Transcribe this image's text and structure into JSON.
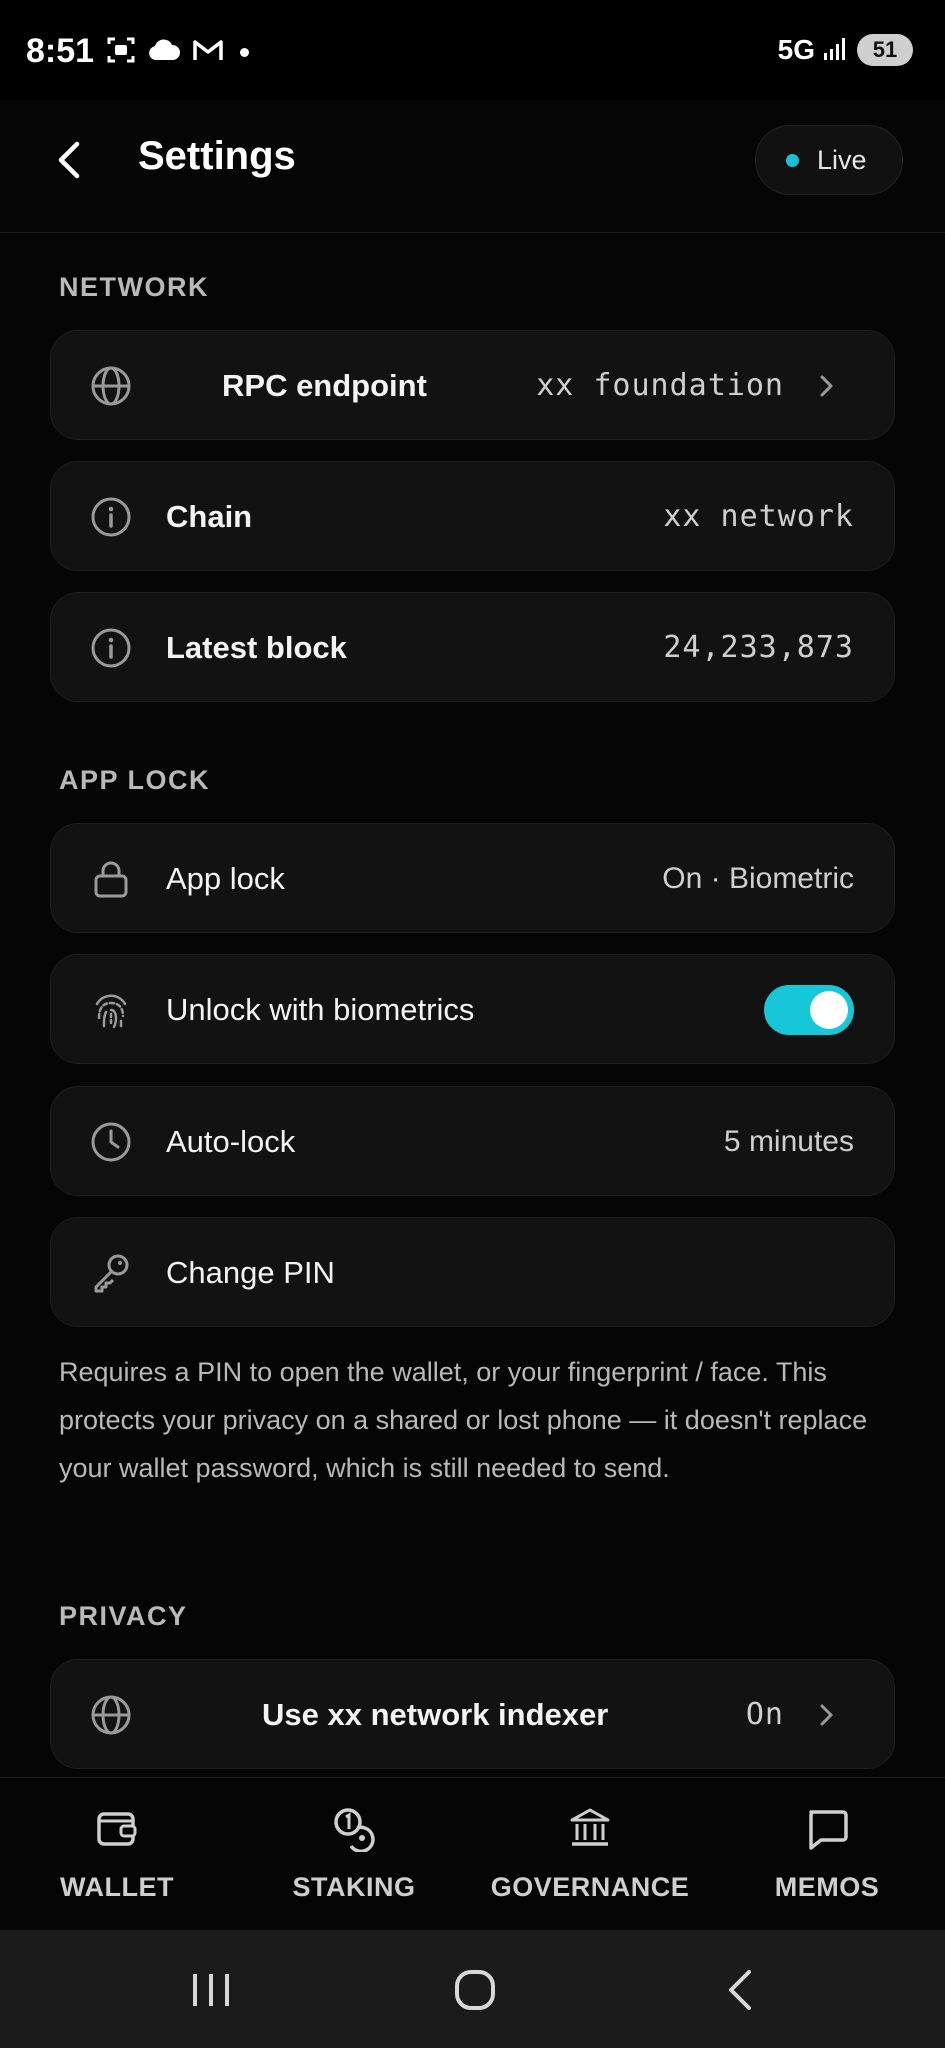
{
  "status_bar": {
    "time": "8:51",
    "network": "5G",
    "battery": "51",
    "icons": [
      "screenshot-icon",
      "cloud-icon",
      "gmail-icon",
      "notification-dot-icon",
      "signal-icon"
    ]
  },
  "header": {
    "title": "Settings",
    "status_label": "Live",
    "status_color": "#17c1d6"
  },
  "sections": {
    "network": {
      "label": "NETWORK",
      "rows": [
        {
          "label": "RPC endpoint",
          "value": "xx foundation",
          "icon": "globe-icon"
        },
        {
          "label": "Chain",
          "value": "xx network",
          "icon": "info-icon"
        },
        {
          "label": "Latest block",
          "value": "24,233,873",
          "icon": "info-icon"
        }
      ]
    },
    "app_lock": {
      "label": "APP LOCK",
      "rows": [
        {
          "label": "App lock",
          "value": "On · Biometric",
          "icon": "lock-icon"
        },
        {
          "label": "Unlock with biometrics",
          "toggle_on": true,
          "icon": "fingerprint-icon"
        },
        {
          "label": "Auto-lock",
          "value": "5 minutes",
          "icon": "clock-icon"
        },
        {
          "label": "Change PIN",
          "icon": "key-icon"
        }
      ],
      "help": "Requires a PIN to open the wallet, or your fingerprint / face. This protects your privacy on a shared or lost phone — it doesn't replace your wallet password, which is still needed to send."
    },
    "privacy": {
      "label": "PRIVACY",
      "rows": [
        {
          "label": "Use xx network indexer",
          "value": "On",
          "icon": "globe-icon"
        }
      ]
    }
  },
  "bottom_nav": [
    {
      "label": "WALLET",
      "icon": "wallet-icon"
    },
    {
      "label": "STAKING",
      "icon": "coins-icon"
    },
    {
      "label": "GOVERNANCE",
      "icon": "bank-icon"
    },
    {
      "label": "MEMOS",
      "icon": "chat-icon"
    }
  ],
  "accent_color": "#16c6d9"
}
